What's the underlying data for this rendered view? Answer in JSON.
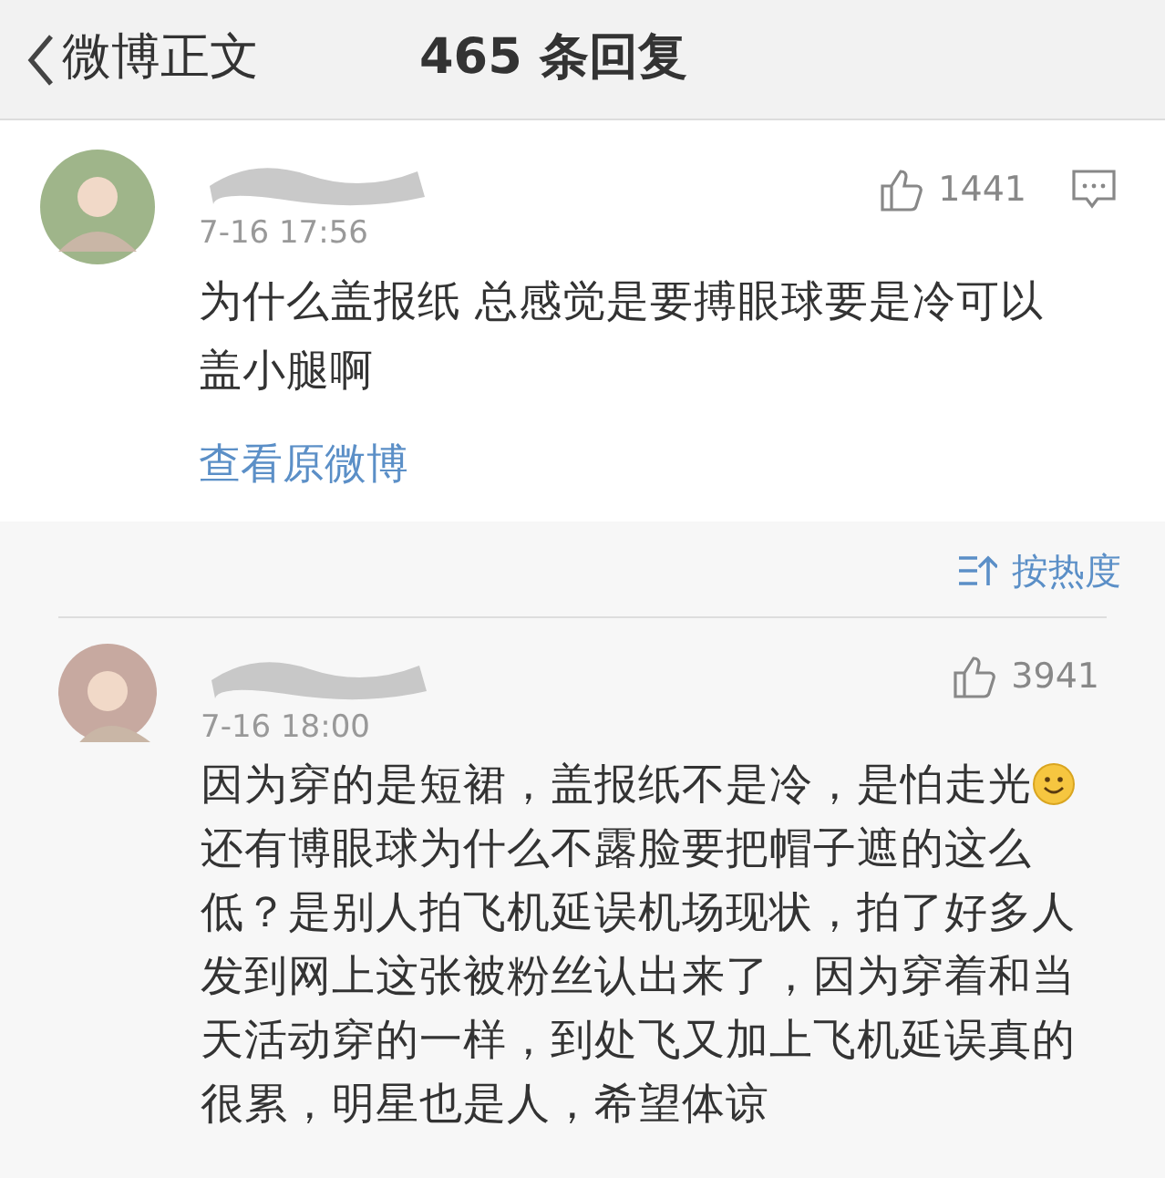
{
  "header": {
    "back_label": "微博正文",
    "title": "465 条回复"
  },
  "post": {
    "name_redacted": true,
    "date": "7-16 17:56",
    "likes": "1441",
    "text": "为什么盖报纸 总感觉是要搏眼球要是冷可以盖小腿啊",
    "link": "查看原微博"
  },
  "sort": {
    "label": "按热度"
  },
  "replies": [
    {
      "name_redacted": true,
      "date": "7-16 18:00",
      "likes": "3941",
      "body": [
        {
          "kind": "text",
          "text": "因为穿的是短裙，盖报纸不是冷，是怕走光"
        },
        {
          "kind": "emoji"
        },
        {
          "kind": "text",
          "text": "还有博眼球为什么不露脸要把帽子遮的这么低？是别人拍飞机延误机场现状，拍了好多人发到网上这张被粉丝认出来了，因为穿着和当天活动穿的一样，到处飞又加上飞机延误真的很累，明星也是人，希望体谅"
        }
      ]
    }
  ]
}
